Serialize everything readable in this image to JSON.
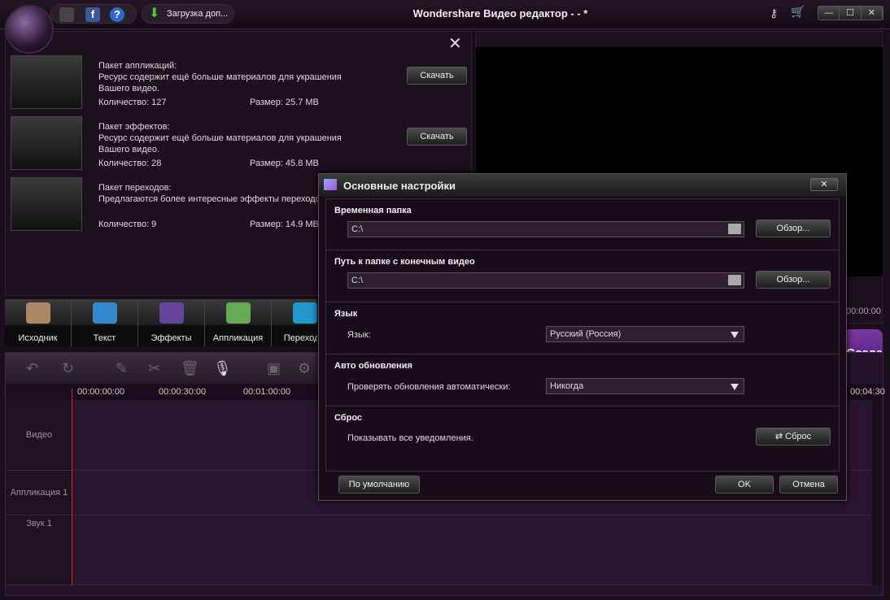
{
  "window": {
    "title": "Wondershare Видео редактор - - *",
    "download_label": "Загрузка доп...",
    "controls": [
      "—",
      "☐",
      "✕"
    ]
  },
  "packages": [
    {
      "title": "Пакет аппликаций:",
      "desc": "Ресурс содержит ещё больше материалов для украшения Вашего видео.",
      "count": "Количество: 127",
      "size": "Размер: 25.7 MB",
      "button": "Скачать"
    },
    {
      "title": "Пакет эффектов:",
      "desc": "Ресурс содержит ещё больше материалов для украшения Вашего видео.",
      "count": "Количество: 28",
      "size": "Размер: 45.8 MB",
      "button": "Скачать"
    },
    {
      "title": "Пакет переходов:",
      "desc": " Предлагаются более интересные эффекты переходов",
      "count": "Количество: 9",
      "size": "Размер: 14.9 MB",
      "button": ""
    }
  ],
  "media_tabs": [
    "Исходник",
    "Текст",
    "Эффекты",
    "Аппликация",
    "Переходы"
  ],
  "preview": {
    "time": "00:00:00",
    "create_label": "Создать"
  },
  "ruler": [
    "00:00:00:00",
    "00:00:30:00",
    "00:01:00:00",
    "00:04:30"
  ],
  "tracks": [
    "Видео",
    "Аппликация 1",
    "Звук 1"
  ],
  "dialog": {
    "title": "Основные настройки",
    "temp_folder": {
      "heading": "Временная папка",
      "value": "C:\\",
      "button": "Обзор..."
    },
    "output_folder": {
      "heading": "Путь к папке с конечным видео",
      "value": "C:\\",
      "button": "Обзор..."
    },
    "language": {
      "heading": "Язык",
      "label": "Язык:",
      "value": "Русский (Россия)"
    },
    "updates": {
      "heading": "Авто обновления",
      "label": "Проверять обновления автоматически:",
      "value": "Никогда"
    },
    "reset": {
      "heading": "Сброс",
      "label": "Показывать все уведомления.",
      "button": "Сброс"
    },
    "default_button": "По умолчанию",
    "ok_button": "OK",
    "cancel_button": "Отмена"
  }
}
